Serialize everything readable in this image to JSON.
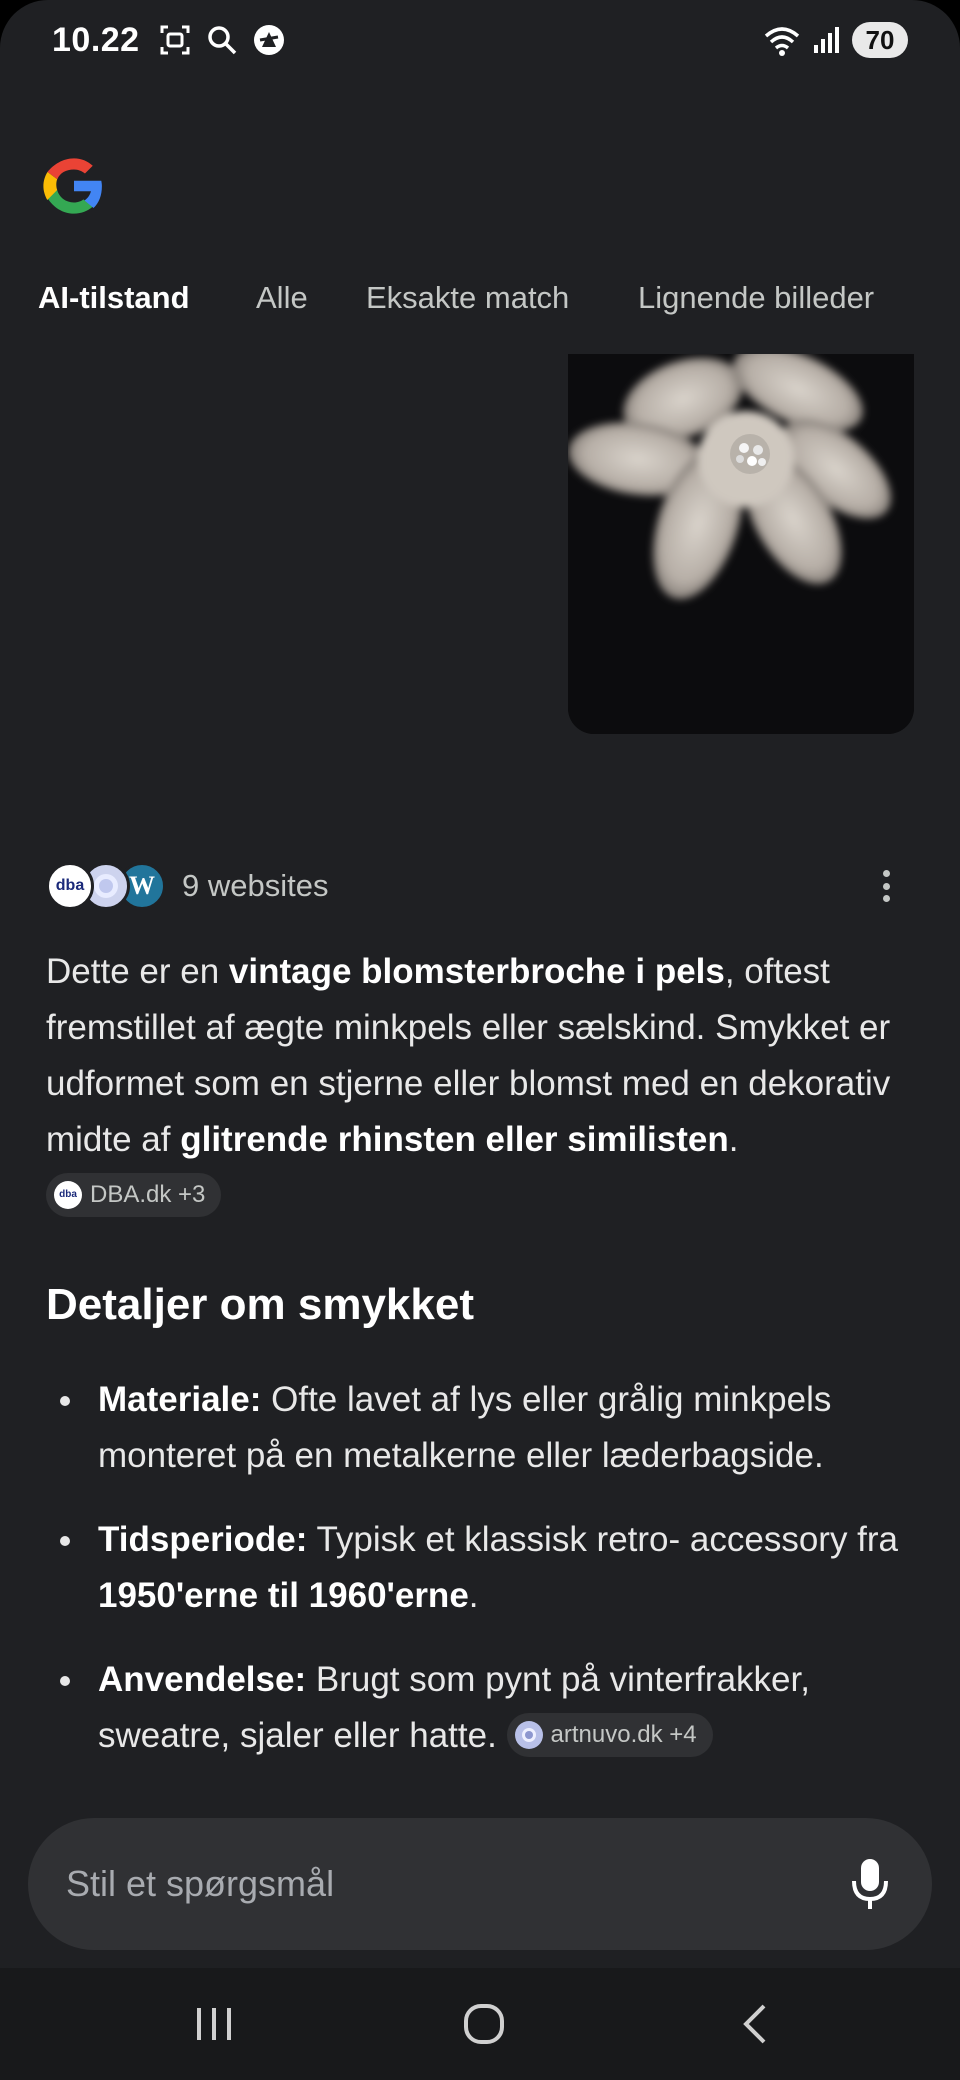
{
  "status_bar": {
    "time": "10.22",
    "battery": "70",
    "left_icons": [
      "screenshot-icon",
      "search-icon",
      "app-icon"
    ],
    "right_icons": [
      "wifi-icon",
      "signal-icon"
    ]
  },
  "tabs": [
    {
      "label": "AI-tilstand",
      "active": true
    },
    {
      "label": "Alle",
      "active": false
    },
    {
      "label": "Eksakte match",
      "active": false
    },
    {
      "label": "Lignende billeder",
      "active": false
    }
  ],
  "sources": {
    "label": "9 websites",
    "favicons": [
      "dba",
      "globe",
      "wordpress"
    ],
    "dba_text": "dba"
  },
  "answer": {
    "p1": "Dette er en ",
    "p1_bold": "vintage blomsterbroche i pels",
    "p2": ", oftest fremstillet af ægte minkpels eller sælskind. Smykket er udformet som en stjerne eller blomst med en dekorativ midte af ",
    "p2_bold": "glitrende rhinsten eller similisten",
    "p3": ". ",
    "chip": "DBA.dk +3"
  },
  "section": {
    "heading": "Detaljer om smykket",
    "bullets": [
      {
        "title": "Materiale:",
        "text": " Ofte lavet af lys eller grålig minkpels monteret på en metalkerne eller læderbagside."
      },
      {
        "title": "Tidsperiode:",
        "text": " Typisk et klassisk retro- accessory fra ",
        "bold": "1950'erne til 1960'erne",
        "tail": "."
      },
      {
        "title": "Anvendelse:",
        "text": " Brugt som pynt på vinterfrakker, sweatre, sjaler eller hatte. ",
        "chip": "artnuvo.dk +4"
      }
    ]
  },
  "ask": {
    "placeholder": "Stil et spørgsmål"
  },
  "colors": {
    "background": "#1f2023",
    "chip": "#303134",
    "text": "#e8e8e8"
  }
}
